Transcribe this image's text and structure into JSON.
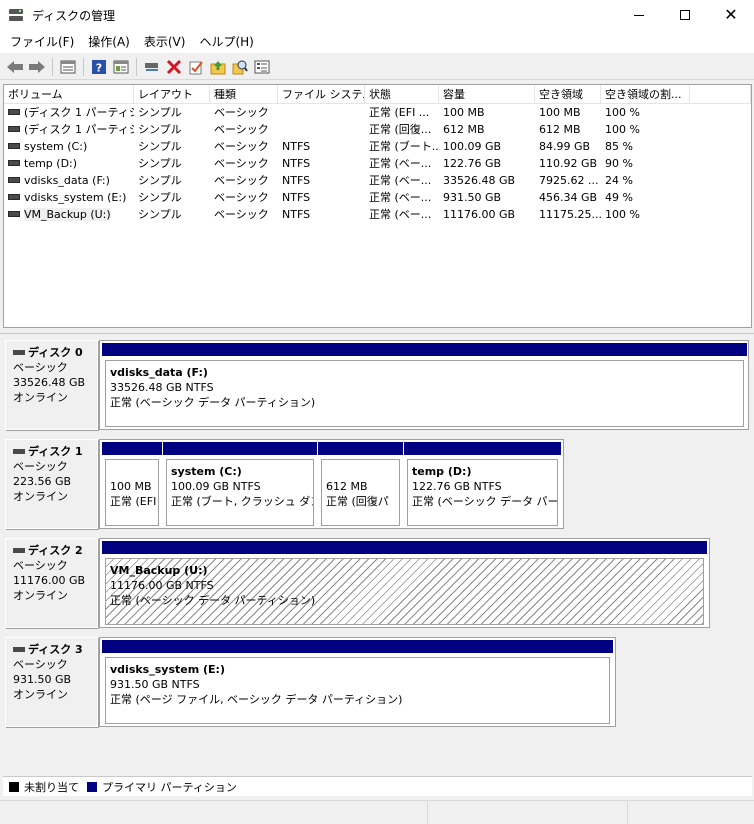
{
  "window": {
    "title": "ディスクの管理"
  },
  "menu": [
    {
      "label": "ファイル(F)"
    },
    {
      "label": "操作(A)"
    },
    {
      "label": "表示(V)"
    },
    {
      "label": "ヘルプ(H)"
    }
  ],
  "volume_list": {
    "columns": [
      "ボリューム",
      "レイアウト",
      "種類",
      "ファイル システム",
      "状態",
      "容量",
      "空き領域",
      "空き領域の割..."
    ],
    "rows": [
      {
        "name": "(ディスク 1 パーティシ...",
        "layout": "シンプル",
        "type": "ベーシック",
        "fs": "",
        "status": "正常 (EFI ...",
        "capacity": "100 MB",
        "free": "100 MB",
        "pct": "100 %"
      },
      {
        "name": "(ディスク 1 パーティシ...",
        "layout": "シンプル",
        "type": "ベーシック",
        "fs": "",
        "status": "正常 (回復...",
        "capacity": "612 MB",
        "free": "612 MB",
        "pct": "100 %"
      },
      {
        "name": "system (C:)",
        "layout": "シンプル",
        "type": "ベーシック",
        "fs": "NTFS",
        "status": "正常 (ブート...",
        "capacity": "100.09 GB",
        "free": "84.99 GB",
        "pct": "85 %"
      },
      {
        "name": "temp (D:)",
        "layout": "シンプル",
        "type": "ベーシック",
        "fs": "NTFS",
        "status": "正常 (ベー...",
        "capacity": "122.76 GB",
        "free": "110.92 GB",
        "pct": "90 %"
      },
      {
        "name": "vdisks_data (F:)",
        "layout": "シンプル",
        "type": "ベーシック",
        "fs": "NTFS",
        "status": "正常 (ベー...",
        "capacity": "33526.48 GB",
        "free": "7925.62 ...",
        "pct": "24 %"
      },
      {
        "name": "vdisks_system (E:)",
        "layout": "シンプル",
        "type": "ベーシック",
        "fs": "NTFS",
        "status": "正常 (ベー...",
        "capacity": "931.50 GB",
        "free": "456.34 GB",
        "pct": "49 %"
      },
      {
        "name": "VM_Backup (U:)",
        "layout": "シンプル",
        "type": "ベーシック",
        "fs": "NTFS",
        "status": "正常 (ベー...",
        "capacity": "11176.00 GB",
        "free": "11175.25...",
        "pct": "100 %"
      }
    ]
  },
  "disks": [
    {
      "name": "ディスク 0",
      "type": "ベーシック",
      "size": "33526.48 GB",
      "state": "オンライン",
      "partitions": [
        {
          "title": "vdisks_data  (F:)",
          "size": "33526.48 GB NTFS",
          "status": "正常 (ベーシック データ パーティション)"
        }
      ]
    },
    {
      "name": "ディスク 1",
      "type": "ベーシック",
      "size": "223.56 GB",
      "state": "オンライン",
      "partitions": [
        {
          "title": "",
          "size": "100 MB",
          "status": "正常 (EFI"
        },
        {
          "title": "system  (C:)",
          "size": "100.09 GB NTFS",
          "status": "正常 (ブート, クラッシュ ダンプ,"
        },
        {
          "title": "",
          "size": "612 MB",
          "status": "正常 (回復パ"
        },
        {
          "title": "temp  (D:)",
          "size": "122.76 GB NTFS",
          "status": "正常 (ベーシック データ パーティ"
        }
      ]
    },
    {
      "name": "ディスク 2",
      "type": "ベーシック",
      "size": "11176.00 GB",
      "state": "オンライン",
      "partitions": [
        {
          "title": "VM_Backup  (U:)",
          "size": "11176.00 GB NTFS",
          "status": "正常 (ベーシック データ パーティション)"
        }
      ]
    },
    {
      "name": "ディスク 3",
      "type": "ベーシック",
      "size": "931.50 GB",
      "state": "オンライン",
      "partitions": [
        {
          "title": "vdisks_system  (E:)",
          "size": "931.50 GB NTFS",
          "status": "正常 (ページ ファイル, ベーシック データ パーティション)"
        }
      ]
    }
  ],
  "legend": [
    {
      "label": "未割り当て",
      "color": "#000000"
    },
    {
      "label": "プライマリ パーティション",
      "color": "#000080"
    }
  ],
  "colors": {
    "partition_bar": "#000080",
    "window_bg": "#f0f0f0"
  },
  "toolbar_icons": [
    "back-icon",
    "forward-icon",
    "list-view-icon",
    "help-icon",
    "properties-icon",
    "connect-drive-icon",
    "delete-icon",
    "check-icon",
    "up-folder-icon",
    "search-icon",
    "settings-list-icon"
  ]
}
